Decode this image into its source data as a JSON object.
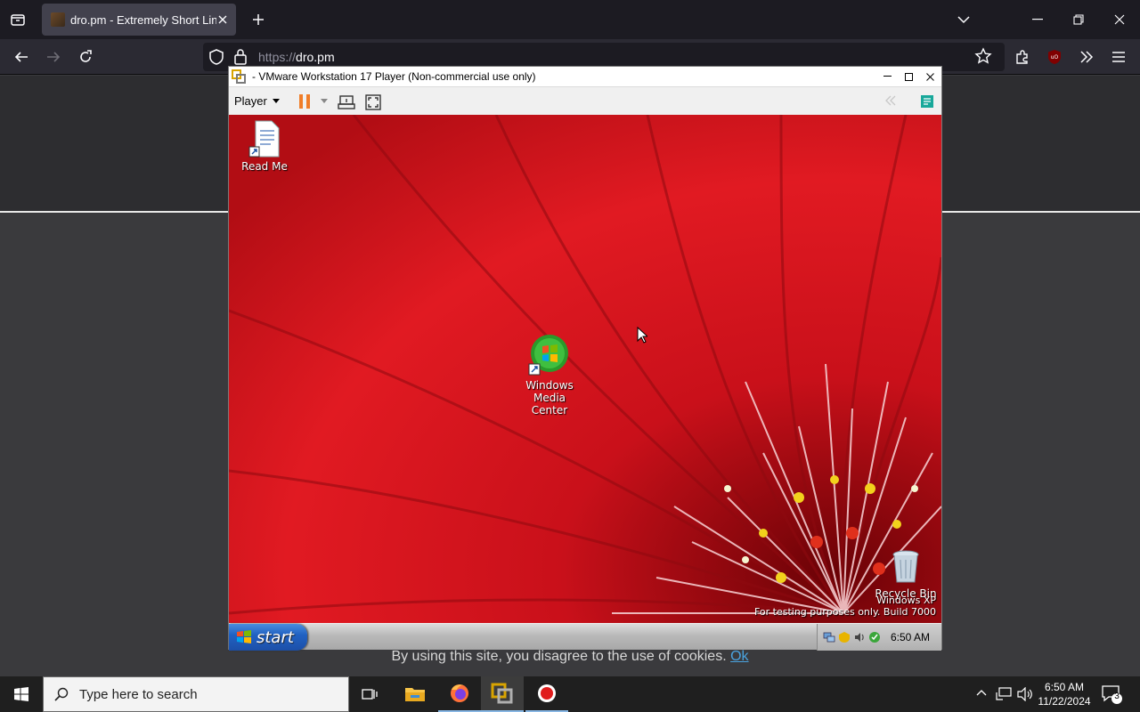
{
  "browser": {
    "tab_title": "dro.pm - Extremely Short Links",
    "url_scheme": "https://",
    "url_host": "dro.pm"
  },
  "vmware": {
    "title": "- VMware Workstation 17 Player (Non-commercial use only)",
    "player_menu": "Player"
  },
  "guest": {
    "desktop_icons": [
      {
        "label": "Read Me"
      },
      {
        "label_line1": "Windows",
        "label_line2": "Media Center"
      },
      {
        "label": "Recycle Bin"
      }
    ],
    "watermark_line1": "Windows XP",
    "watermark_line2": "For testing purposes only. Build 7000",
    "start_label": "start",
    "clock": "6:50 AM"
  },
  "page": {
    "cookie_text": "By using this site, you disagree to the use of cookies.",
    "cookie_ok": "Ok"
  },
  "host_taskbar": {
    "search_placeholder": "Type here to search",
    "time": "6:50 AM",
    "date": "11/22/2024",
    "notification_count": "3"
  }
}
